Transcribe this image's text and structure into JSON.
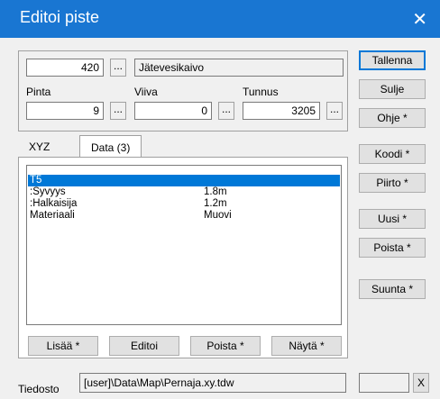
{
  "window": {
    "title": "Editoi piste",
    "close_icon": "close-icon"
  },
  "top": {
    "number_value": "420",
    "dots": "...",
    "type_text": "Jätevesikaivo",
    "pinta_label": "Pinta",
    "pinta_value": "9",
    "viiva_label": "Viiva",
    "viiva_value": "0",
    "tunnus_label": "Tunnus",
    "tunnus_value": "3205"
  },
  "side_buttons": {
    "tallenna": "Tallenna",
    "sulje": "Sulje",
    "ohje": "Ohje *",
    "koodi": "Koodi *",
    "piirto": "Piirto *",
    "uusi": "Uusi *",
    "poista": "Poista *",
    "suunta": "Suunta *"
  },
  "tabs": {
    "xyz": "XYZ",
    "data": "Data (3)"
  },
  "list": {
    "rows": [
      {
        "name": "T5",
        "value": ""
      },
      {
        "name": ":Syvyys",
        "value": "1.8m"
      },
      {
        "name": ":Halkaisija",
        "value": "1.2m"
      },
      {
        "name": "Materiaali",
        "value": "Muovi"
      }
    ],
    "selected_index": 0
  },
  "panel_buttons": {
    "lisaa": "Lisää *",
    "editoi": "Editoi",
    "poista": "Poista *",
    "nayta": "Näytä *"
  },
  "footer": {
    "label": "Tiedosto",
    "path": "[user]\\Data\\Map\\Pernaja.xy.tdw",
    "x_button": "X"
  }
}
